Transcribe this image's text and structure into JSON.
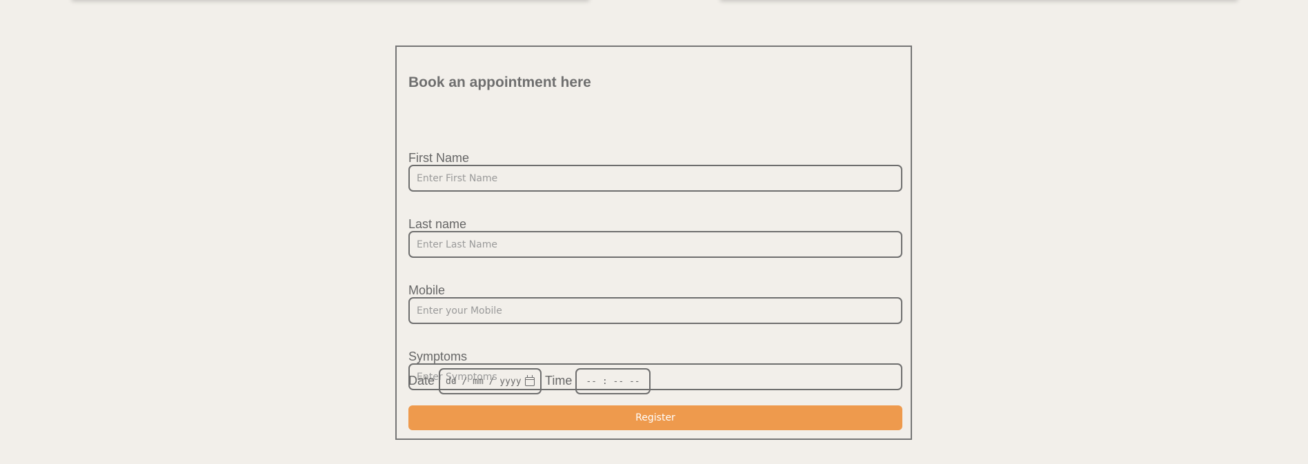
{
  "form": {
    "title": "Book an appointment here",
    "fields": [
      {
        "label": "First Name",
        "placeholder": "Enter First Name",
        "value": ""
      },
      {
        "label": "Last name",
        "placeholder": "Enter Last Name",
        "value": ""
      },
      {
        "label": "Mobile",
        "placeholder": "Enter your Mobile",
        "value": ""
      },
      {
        "label": "Symptoms",
        "placeholder": "Enter Symptoms",
        "value": ""
      }
    ],
    "date": {
      "label": "Date",
      "placeholder": "dd / mm / yyyy"
    },
    "time": {
      "label": "Time",
      "placeholder": "-- : --  --"
    },
    "register_label": "Register"
  },
  "colors": {
    "background": "#f2efea",
    "accent": "#ee9a4d",
    "border": "#757575"
  },
  "icons": [
    "calendar-icon"
  ]
}
